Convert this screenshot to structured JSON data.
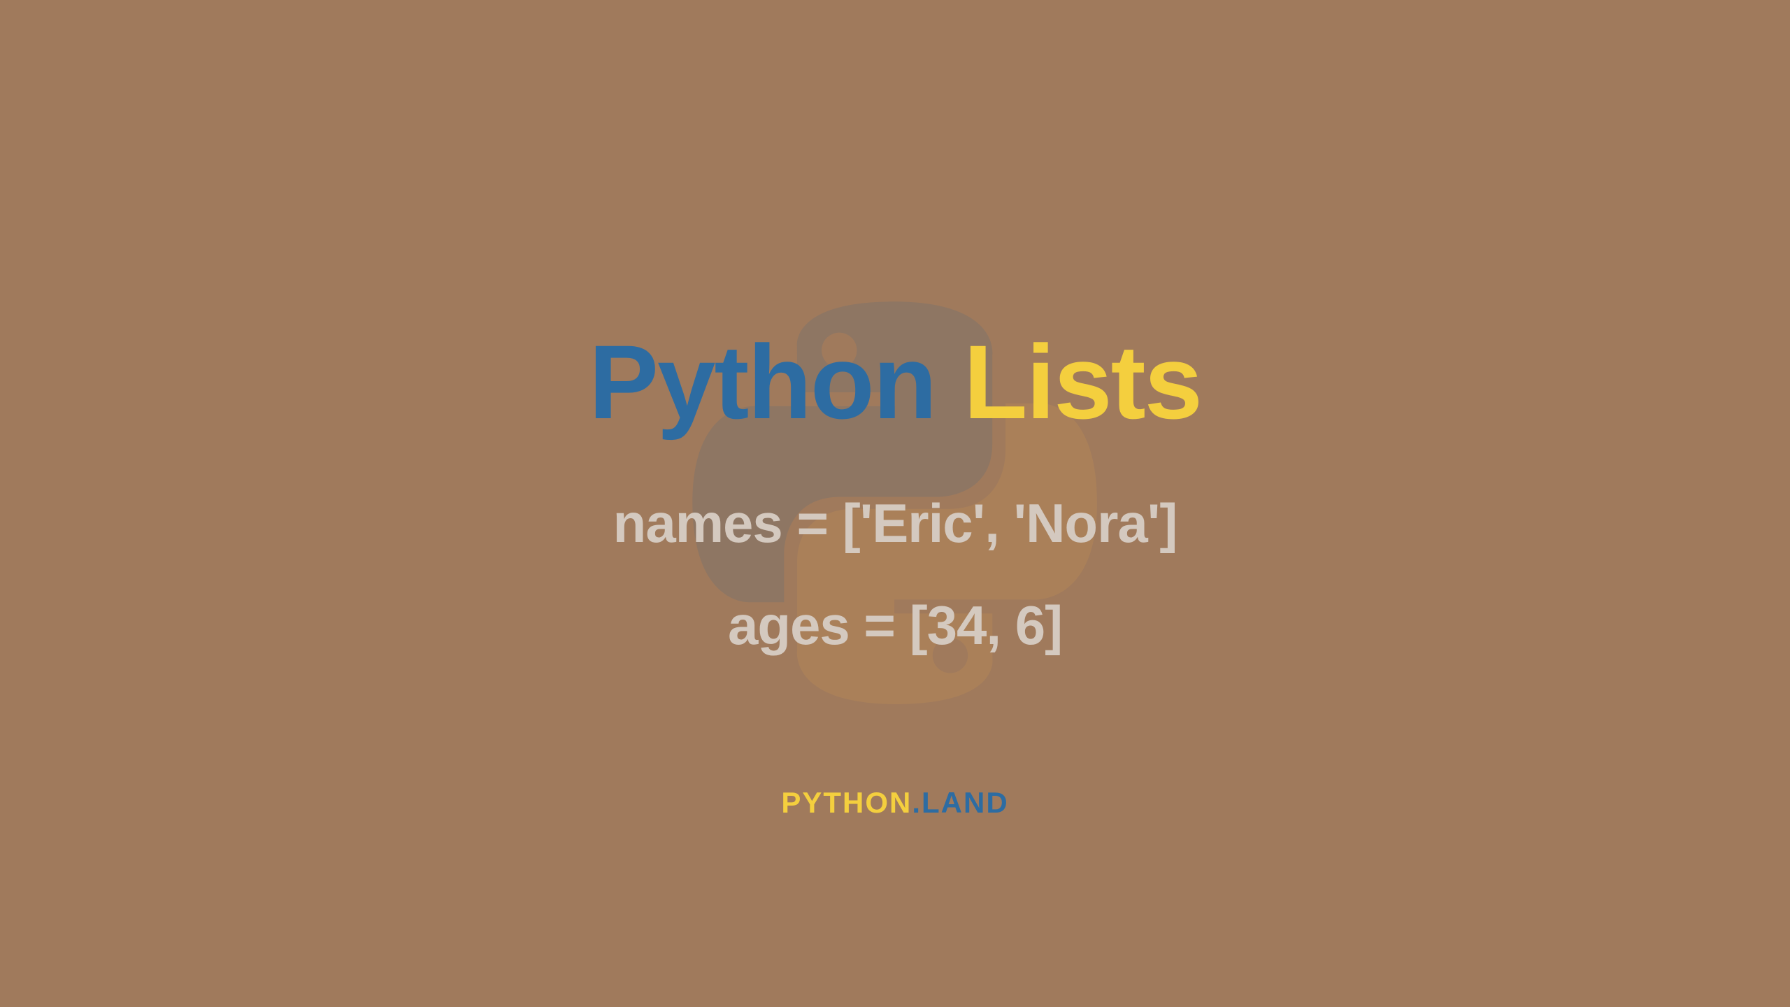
{
  "title": {
    "word1": "Python",
    "word2": "Lists"
  },
  "code": {
    "line1": "names = ['Eric', 'Nora']",
    "line2": "ages = [34, 6]"
  },
  "footer": {
    "part1": "PYTHON",
    "dot": ".",
    "part2": "LAND"
  }
}
